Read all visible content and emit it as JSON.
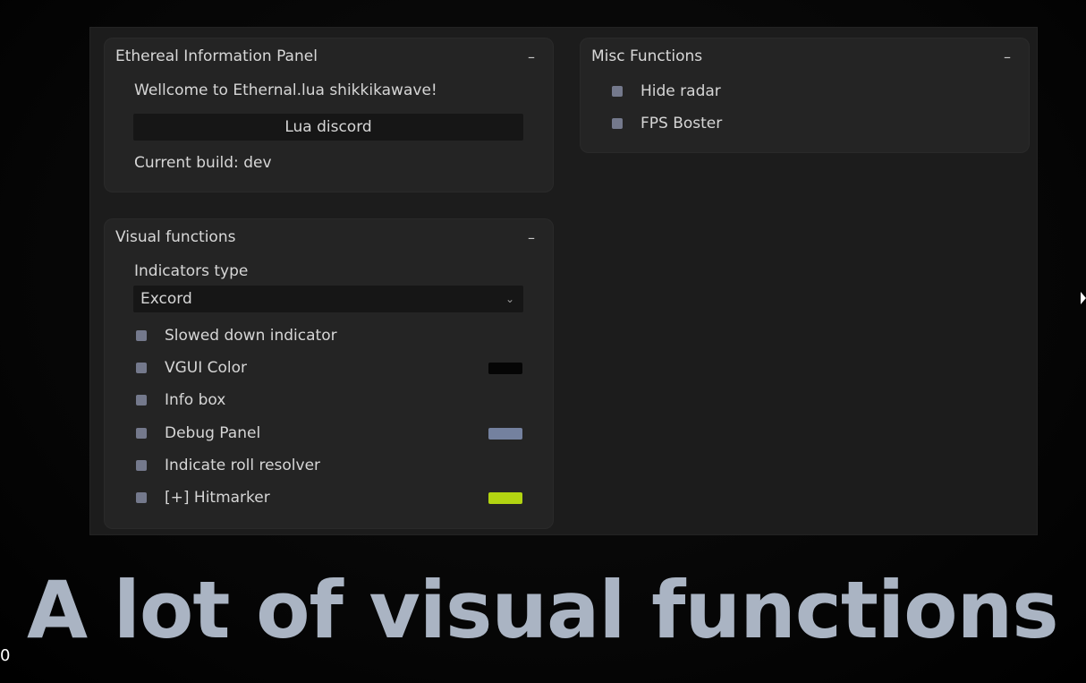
{
  "info_panel": {
    "title": "Ethereal Information Panel",
    "collapse": "–",
    "welcome": "Wellcome to Ethernal.lua shikkikawave!",
    "discord_button": "Lua discord",
    "build": "Current build: dev"
  },
  "misc_panel": {
    "title": "Misc Functions",
    "collapse": "–",
    "items": [
      {
        "label": "Hide radar",
        "checked": false
      },
      {
        "label": "FPS Boster",
        "checked": false
      }
    ]
  },
  "visual_panel": {
    "title": "Visual functions",
    "collapse": "–",
    "indicators_label": "Indicators type",
    "indicators_value": "Excord",
    "items": [
      {
        "label": "Slowed down indicator",
        "checked": false,
        "color": null
      },
      {
        "label": "VGUI Color",
        "checked": false,
        "color": "#050505"
      },
      {
        "label": "Info box",
        "checked": false,
        "color": null
      },
      {
        "label": "Debug Panel",
        "checked": false,
        "color": "#74819f"
      },
      {
        "label": "Indicate roll resolver",
        "checked": false,
        "color": null
      },
      {
        "label": "[+] Hitmarker",
        "checked": false,
        "color": "#b2d411"
      }
    ]
  },
  "overlay": {
    "caption": "A lot of visual functions",
    "corner_text": "0"
  },
  "colors": {
    "checkbox": "#74798c",
    "panel_bg": "#242424",
    "window_bg": "#1c1c1c"
  }
}
